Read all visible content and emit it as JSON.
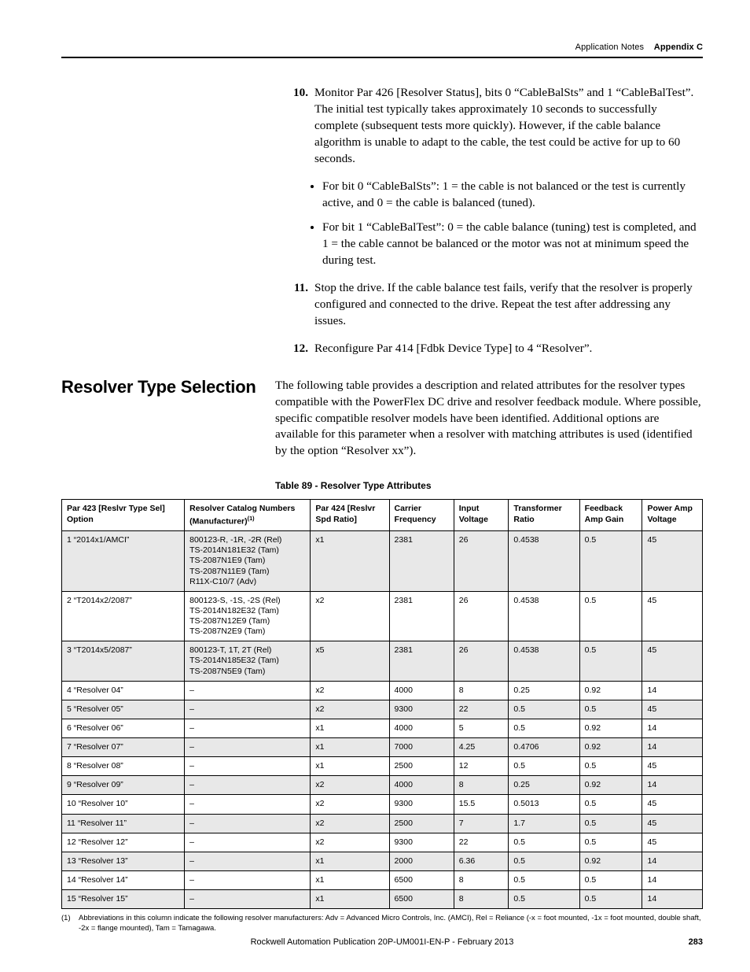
{
  "header": {
    "left": "Application Notes",
    "right": "Appendix C"
  },
  "steps": {
    "s10": "Monitor Par 426 [Resolver Status], bits 0 “CableBalSts” and 1 “CableBalTest”. The initial test typically takes approximately 10 seconds to successfully complete (subsequent tests more quickly). However, if the cable balance algorithm is unable to adapt to the cable, the test could be active for up to 60 seconds.",
    "s10b1": "For bit 0 “CableBalSts”: 1 = the cable is not balanced or the test is currently active, and 0 = the cable is balanced (tuned).",
    "s10b2": "For bit 1 “CableBalTest”: 0 = the cable balance (tuning) test is completed, and 1 = the cable cannot be balanced or the motor was not at minimum speed the during test.",
    "s11": "Stop the drive. If the cable balance test fails, verify that the resolver is properly configured and connected to the drive. Repeat the test after addressing any issues.",
    "s12": "Reconfigure Par 414 [Fdbk Device Type] to 4 “Resolver”."
  },
  "section": {
    "title": "Resolver Type Selection",
    "para": "The following table provides a description and related attributes for the resolver types compatible with the PowerFlex DC drive and resolver feedback module. Where possible, specific compatible resolver models have been identified. Additional options are available for this parameter when a resolver with matching attributes is used (identified by the option “Resolver xx”)."
  },
  "table": {
    "caption": "Table 89 - Resolver Type Attributes",
    "head": {
      "c1": "Par 423 [Reslvr Type Sel] Option",
      "c2a": "Resolver Catalog Numbers (Manufacturer)",
      "c2sup": "(1)",
      "c3": "Par 424 [Reslvr Spd Ratio]",
      "c4": "Carrier Frequency",
      "c5": "Input Voltage",
      "c6": "Transformer Ratio",
      "c7": "Feedback Amp Gain",
      "c8": "Power Amp Voltage"
    },
    "rows": [
      {
        "shade": true,
        "c1": "1 “2014x1/AMCI”",
        "c2": "800123-R, -1R, -2R (Rel)\nTS-2014N181E32 (Tam)\nTS-2087N1E9 (Tam)\nTS-2087N11E9 (Tam)\nR11X-C10/7 (Adv)",
        "c3": "x1",
        "c4": "2381",
        "c5": "26",
        "c6": "0.4538",
        "c7": "0.5",
        "c8": "45"
      },
      {
        "shade": false,
        "c1": "2 “T2014x2/2087”",
        "c2": "800123-S, -1S, -2S (Rel)\nTS-2014N182E32 (Tam)\nTS-2087N12E9 (Tam)\nTS-2087N2E9 (Tam)",
        "c3": "x2",
        "c4": "2381",
        "c5": "26",
        "c6": "0.4538",
        "c7": "0.5",
        "c8": "45"
      },
      {
        "shade": true,
        "c1": "3 “T2014x5/2087”",
        "c2": "800123-T, 1T, 2T (Rel)\nTS-2014N185E32 (Tam)\nTS-2087N5E9 (Tam)",
        "c3": "x5",
        "c4": "2381",
        "c5": "26",
        "c6": "0.4538",
        "c7": "0.5",
        "c8": "45"
      },
      {
        "shade": false,
        "c1": "4 “Resolver 04”",
        "c2": "–",
        "c3": "x2",
        "c4": "4000",
        "c5": "8",
        "c6": "0.25",
        "c7": "0.92",
        "c8": "14"
      },
      {
        "shade": true,
        "c1": "5 “Resolver 05”",
        "c2": "–",
        "c3": "x2",
        "c4": "9300",
        "c5": "22",
        "c6": "0.5",
        "c7": "0.5",
        "c8": "45"
      },
      {
        "shade": false,
        "c1": "6 “Resolver 06”",
        "c2": "–",
        "c3": "x1",
        "c4": "4000",
        "c5": "5",
        "c6": "0.5",
        "c7": "0.92",
        "c8": "14"
      },
      {
        "shade": true,
        "c1": "7 “Resolver 07”",
        "c2": "–",
        "c3": "x1",
        "c4": "7000",
        "c5": "4.25",
        "c6": "0.4706",
        "c7": "0.92",
        "c8": "14"
      },
      {
        "shade": false,
        "c1": "8 “Resolver 08”",
        "c2": "–",
        "c3": "x1",
        "c4": "2500",
        "c5": "12",
        "c6": "0.5",
        "c7": "0.5",
        "c8": "45"
      },
      {
        "shade": true,
        "c1": "9 “Resolver 09”",
        "c2": "–",
        "c3": "x2",
        "c4": "4000",
        "c5": "8",
        "c6": "0.25",
        "c7": "0.92",
        "c8": "14"
      },
      {
        "shade": false,
        "c1": "10 “Resolver 10”",
        "c2": "–",
        "c3": "x2",
        "c4": "9300",
        "c5": "15.5",
        "c6": "0.5013",
        "c7": "0.5",
        "c8": "45"
      },
      {
        "shade": true,
        "c1": "11 “Resolver 11”",
        "c2": "–",
        "c3": "x2",
        "c4": "2500",
        "c5": "7",
        "c6": "1.7",
        "c7": "0.5",
        "c8": "45"
      },
      {
        "shade": false,
        "c1": "12 “Resolver 12”",
        "c2": "–",
        "c3": "x2",
        "c4": "9300",
        "c5": "22",
        "c6": "0.5",
        "c7": "0.5",
        "c8": "45"
      },
      {
        "shade": true,
        "c1": "13 “Resolver 13”",
        "c2": "–",
        "c3": "x1",
        "c4": "2000",
        "c5": "6.36",
        "c6": "0.5",
        "c7": "0.92",
        "c8": "14"
      },
      {
        "shade": false,
        "c1": "14 “Resolver 14”",
        "c2": "–",
        "c3": "x1",
        "c4": "6500",
        "c5": "8",
        "c6": "0.5",
        "c7": "0.5",
        "c8": "14"
      },
      {
        "shade": true,
        "c1": "15 “Resolver 15”",
        "c2": "–",
        "c3": "x1",
        "c4": "6500",
        "c5": "8",
        "c6": "0.5",
        "c7": "0.5",
        "c8": "14"
      }
    ]
  },
  "footnote": {
    "num": "(1)",
    "text": "Abbreviations in this column indicate the following resolver manufacturers: Adv = Advanced Micro Controls, Inc. (AMCI), Rel = Reliance (-x = foot mounted, -1x = foot mounted, double shaft, -2x = flange mounted), Tam = Tamagawa."
  },
  "footer": {
    "center": "Rockwell Automation Publication 20P-UM001I-EN-P - February 2013",
    "page": "283"
  },
  "chart_data": {
    "type": "table",
    "title": "Table 89 - Resolver Type Attributes",
    "columns": [
      "Par 423 [Reslvr Type Sel] Option",
      "Resolver Catalog Numbers (Manufacturer)",
      "Par 424 [Reslvr Spd Ratio]",
      "Carrier Frequency",
      "Input Voltage",
      "Transformer Ratio",
      "Feedback Amp Gain",
      "Power Amp Voltage"
    ],
    "rows": [
      [
        "1 \"2014x1/AMCI\"",
        "800123-R, -1R, -2R (Rel); TS-2014N181E32 (Tam); TS-2087N1E9 (Tam); TS-2087N11E9 (Tam); R11X-C10/7 (Adv)",
        "x1",
        2381,
        26,
        0.4538,
        0.5,
        45
      ],
      [
        "2 \"T2014x2/2087\"",
        "800123-S, -1S, -2S (Rel); TS-2014N182E32 (Tam); TS-2087N12E9 (Tam); TS-2087N2E9 (Tam)",
        "x2",
        2381,
        26,
        0.4538,
        0.5,
        45
      ],
      [
        "3 \"T2014x5/2087\"",
        "800123-T, 1T, 2T (Rel); TS-2014N185E32 (Tam); TS-2087N5E9 (Tam)",
        "x5",
        2381,
        26,
        0.4538,
        0.5,
        45
      ],
      [
        "4 \"Resolver 04\"",
        "–",
        "x2",
        4000,
        8,
        0.25,
        0.92,
        14
      ],
      [
        "5 \"Resolver 05\"",
        "–",
        "x2",
        9300,
        22,
        0.5,
        0.5,
        45
      ],
      [
        "6 \"Resolver 06\"",
        "–",
        "x1",
        4000,
        5,
        0.5,
        0.92,
        14
      ],
      [
        "7 \"Resolver 07\"",
        "–",
        "x1",
        7000,
        4.25,
        0.4706,
        0.92,
        14
      ],
      [
        "8 \"Resolver 08\"",
        "–",
        "x1",
        2500,
        12,
        0.5,
        0.5,
        45
      ],
      [
        "9 \"Resolver 09\"",
        "–",
        "x2",
        4000,
        8,
        0.25,
        0.92,
        14
      ],
      [
        "10 \"Resolver 10\"",
        "–",
        "x2",
        9300,
        15.5,
        0.5013,
        0.5,
        45
      ],
      [
        "11 \"Resolver 11\"",
        "–",
        "x2",
        2500,
        7,
        1.7,
        0.5,
        45
      ],
      [
        "12 \"Resolver 12\"",
        "–",
        "x2",
        9300,
        22,
        0.5,
        0.5,
        45
      ],
      [
        "13 \"Resolver 13\"",
        "–",
        "x1",
        2000,
        6.36,
        0.5,
        0.92,
        14
      ],
      [
        "14 \"Resolver 14\"",
        "–",
        "x1",
        6500,
        8,
        0.5,
        0.5,
        14
      ],
      [
        "15 \"Resolver 15\"",
        "–",
        "x1",
        6500,
        8,
        0.5,
        0.5,
        14
      ]
    ]
  }
}
